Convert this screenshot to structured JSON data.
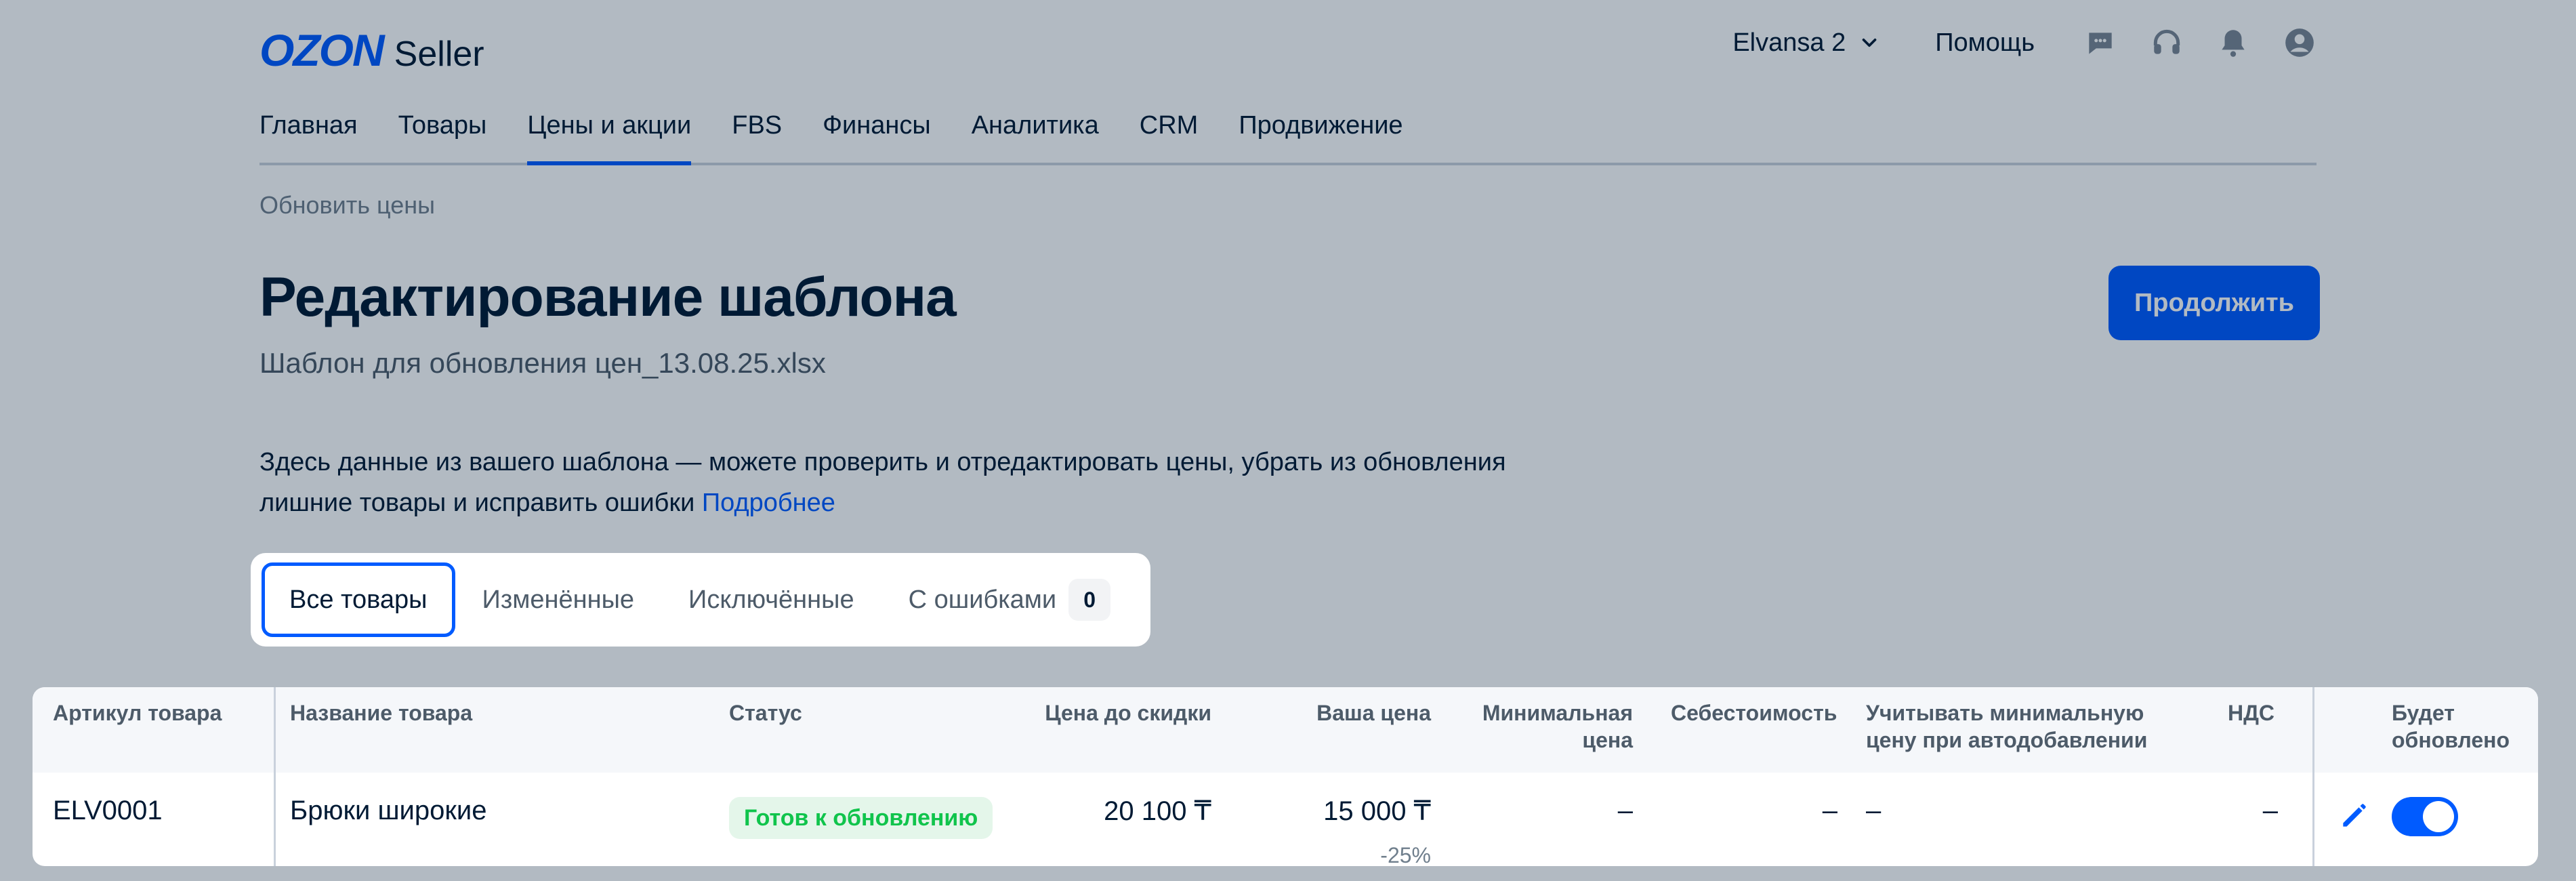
{
  "header": {
    "logo_brand": "OZON",
    "logo_product": "Seller",
    "account_name": "Elvansa 2",
    "help_label": "Помощь",
    "icons": [
      "chat-icon",
      "headset-icon",
      "bell-icon",
      "user-icon"
    ]
  },
  "nav": {
    "items": [
      {
        "label": "Главная",
        "active": false
      },
      {
        "label": "Товары",
        "active": false
      },
      {
        "label": "Цены и акции",
        "active": true
      },
      {
        "label": "FBS",
        "active": false
      },
      {
        "label": "Финансы",
        "active": false
      },
      {
        "label": "Аналитика",
        "active": false
      },
      {
        "label": "CRM",
        "active": false
      },
      {
        "label": "Продвижение",
        "active": false
      }
    ]
  },
  "breadcrumb": "Обновить цены",
  "page": {
    "title": "Редактирование шаблона",
    "subtitle": "Шаблон для обновления цен_13.08.25.xlsx",
    "continue_label": "Продолжить",
    "description_line1": "Здесь данные из вашего шаблона — можете проверить и отредактировать цены, убрать из обновления",
    "description_line2": "лишние товары и исправить ошибки",
    "description_link": "Подробнее"
  },
  "tabs": {
    "items": [
      {
        "label": "Все товары",
        "active": true
      },
      {
        "label": "Изменённые",
        "active": false
      },
      {
        "label": "Исключённые",
        "active": false
      },
      {
        "label": "С ошибками",
        "active": false,
        "badge": "0"
      }
    ]
  },
  "table": {
    "columns": {
      "sku": "Артикул товара",
      "name": "Название товара",
      "status": "Статус",
      "price_before": "Цена до скидки",
      "your_price": "Ваша цена",
      "min_price_1": "Минимальная",
      "min_price_2": "цена",
      "cost": "Себестоимость",
      "consider_min_1": "Учитывать минимальную",
      "consider_min_2": "цену при автодобавлении",
      "vat": "НДС",
      "will_update_1": "Будет",
      "will_update_2": "обновлено"
    },
    "rows": [
      {
        "sku": "ELV0001",
        "name": "Брюки широкие",
        "status": "Готов к обновлению",
        "price_before": "20 100 ₸",
        "your_price": "15 000 ₸",
        "discount": "-25%",
        "min_price": "–",
        "cost": "–",
        "consider_min": "–",
        "vat": "–",
        "will_update": true
      }
    ]
  },
  "colors": {
    "accent": "#005bff",
    "status_ok_text": "#10c44c",
    "status_ok_bg": "#e4f6ea",
    "overlay": "rgba(0,26,52,0.30)"
  }
}
